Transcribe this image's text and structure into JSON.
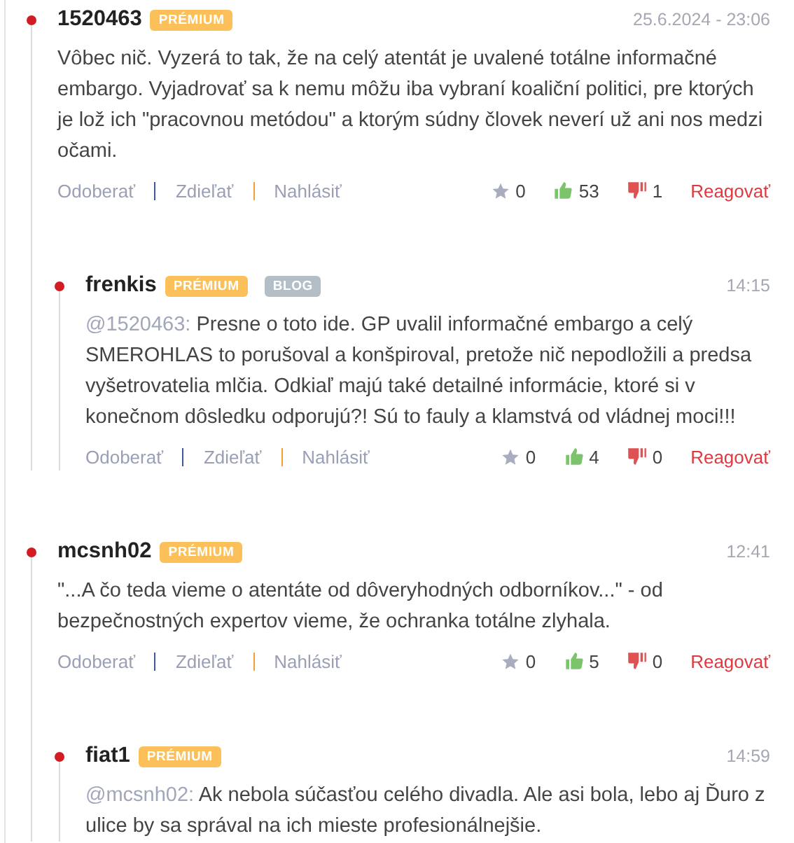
{
  "comments": [
    {
      "author": "1520463",
      "badges": [
        {
          "label": "PRÉMIUM",
          "kind": "premium"
        }
      ],
      "time": "25.6.2024 - 23:06",
      "text": "Vôbec nič. Vyzerá to tak, že na celý atentát je uvalené totálne informačné embargo. Vyjadrovať sa k nemu môžu iba vybraní koaliční politici, pre ktorých je lož ich \"pracovnou metódou\" a ktorým súdny človek neverí už ani nos medzi očami.",
      "actions": [
        "Odoberať",
        "Zdieľať",
        "Nahlásiť"
      ],
      "stars": "0",
      "likes": "53",
      "dislikes": "1",
      "reply": "Reagovať",
      "replies": [
        {
          "author": "frenkis",
          "badges": [
            {
              "label": "PRÉMIUM",
              "kind": "premium"
            },
            {
              "label": "BLOG",
              "kind": "blog"
            }
          ],
          "time": "14:15",
          "mention": "@1520463:",
          "text": "Presne o toto ide. GP uvalil informačné embargo a celý SMEROHLAS to porušoval a konšpiroval, pretože nič nepodložili a predsa vyšetrovatelia mlčia. Odkiaľ majú také detailné informácie, ktoré si v konečnom dôsledku odporujú?! Sú to fauly a klamstvá od vládnej moci!!!",
          "actions": [
            "Odoberať",
            "Zdieľať",
            "Nahlásiť"
          ],
          "stars": "0",
          "likes": "4",
          "dislikes": "0",
          "reply": "Reagovať"
        }
      ]
    },
    {
      "author": "mcsnh02",
      "badges": [
        {
          "label": "PRÉMIUM",
          "kind": "premium"
        }
      ],
      "time": "12:41",
      "text": "\"...A čo teda vieme o atentáte od dôveryhodných odborníkov...\" - od bezpečnostných expertov vieme, že ochranka totálne zlyhala.",
      "actions": [
        "Odoberať",
        "Zdieľať",
        "Nahlásiť"
      ],
      "stars": "0",
      "likes": "5",
      "dislikes": "0",
      "reply": "Reagovať",
      "replies": [
        {
          "author": "fiat1",
          "badges": [
            {
              "label": "PRÉMIUM",
              "kind": "premium"
            }
          ],
          "time": "14:59",
          "mention": "@mcsnh02:",
          "text": "Ak nebola súčasťou celého divadla. Ale asi bola, lebo aj Ďuro z ulice by sa správal na ich mieste profesionálnejšie."
        }
      ]
    }
  ]
}
